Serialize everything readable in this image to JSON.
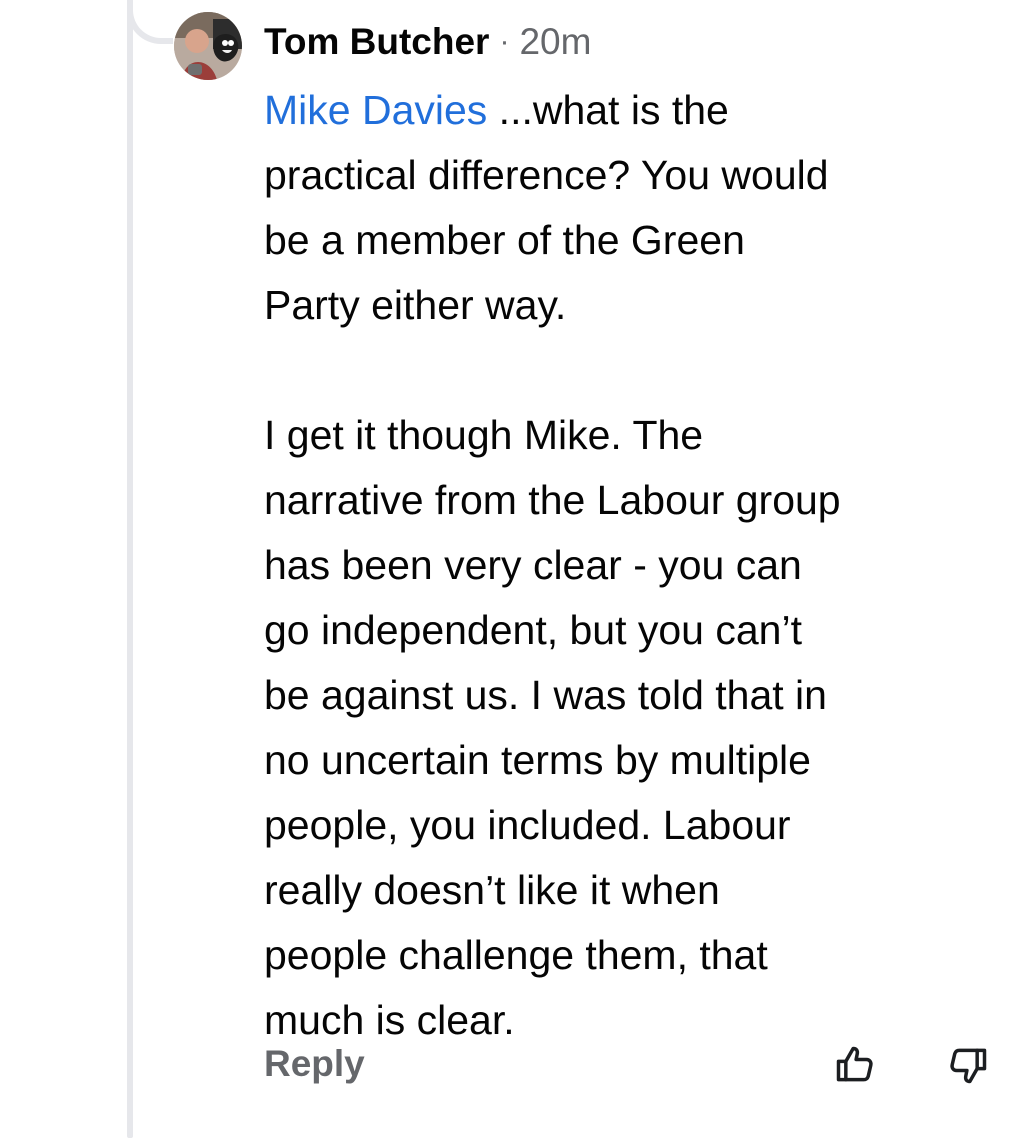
{
  "comment": {
    "author": "Tom Butcher",
    "separator": "·",
    "time": "20m",
    "mention": "Mike Davies",
    "first_line_rest": " ...what is the",
    "lines_para1": [
      "practical difference? You would",
      "be a member of the Green",
      "Party either way."
    ],
    "lines_para2": [
      "I get it though Mike. The",
      "narrative from the Labour group",
      "has been very clear - you can",
      "go independent, but you can’t",
      "be against us. I was told that in",
      "no uncertain terms by multiple",
      "people, you included. Labour",
      "really doesn’t like it when",
      "people challenge them, that",
      "much is clear."
    ]
  },
  "actions": {
    "reply_label": "Reply",
    "upvote_icon": "thumbs-up-icon",
    "downvote_icon": "thumbs-down-icon"
  },
  "colors": {
    "mention": "#216fdb",
    "meta": "#65676b",
    "thread_line": "#e6e7eb"
  }
}
